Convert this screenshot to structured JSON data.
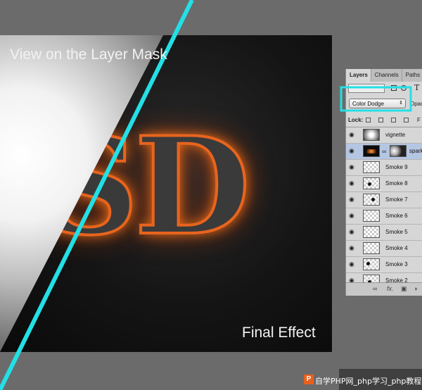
{
  "captions": {
    "mask_view": "View on the Layer Mask",
    "final_effect": "Final Effect"
  },
  "canvas": {
    "letters": "SD"
  },
  "layers_panel": {
    "tabs": [
      {
        "label": "Layers",
        "active": true
      },
      {
        "label": "Channels",
        "active": false
      },
      {
        "label": "Paths",
        "active": false
      }
    ],
    "blend_mode": "Color Dodge",
    "opacity_label": "Opaci",
    "lock_label": "Lock:",
    "fill_label": "F",
    "filter_glyph": "T",
    "layers": [
      {
        "name": "vignette",
        "thumb": "vignette",
        "selected": false
      },
      {
        "name": "spark",
        "thumb": "dark",
        "selected": true
      },
      {
        "name": "Smoke 9",
        "thumb": "checker",
        "selected": false
      },
      {
        "name": "Smoke 8",
        "thumb": "checker",
        "selected": false
      },
      {
        "name": "Smoke 7",
        "thumb": "checker",
        "selected": false
      },
      {
        "name": "Smoke 6",
        "thumb": "checker",
        "selected": false
      },
      {
        "name": "Smoke 5",
        "thumb": "checker",
        "selected": false
      },
      {
        "name": "Smoke 4",
        "thumb": "checker",
        "selected": false
      },
      {
        "name": "Smoke 3",
        "thumb": "checker",
        "selected": false
      },
      {
        "name": "Smoke 2",
        "thumb": "checker",
        "selected": false
      }
    ],
    "footer_icons": [
      "link-icon",
      "fx-icon",
      "add-mask-icon",
      "adjustment-icon"
    ],
    "fx_label": "fx."
  },
  "watermark": {
    "logo": "P",
    "text": "自学PHP网_php学习_php教程"
  },
  "colors": {
    "highlight": "#22e0e6",
    "background": "#6b6b6b",
    "selected_layer": "#b4c6e2"
  }
}
